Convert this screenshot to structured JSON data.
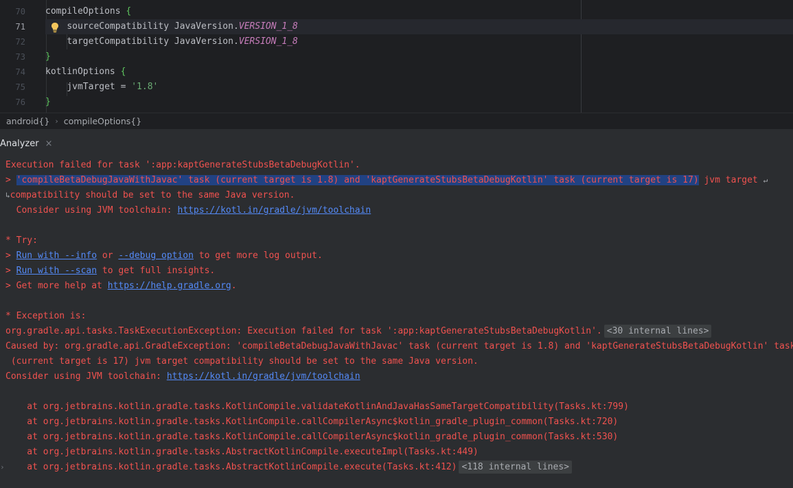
{
  "editor": {
    "line_numbers": [
      "70",
      "71",
      "72",
      "73",
      "74",
      "75",
      "76"
    ],
    "active_line": "71",
    "lines": [
      {
        "indent": "    ",
        "parts": [
          {
            "t": "compileOptions ",
            "c": ""
          },
          {
            "t": "{",
            "c": "c-brace"
          }
        ]
      },
      {
        "indent": "        ",
        "parts": [
          {
            "t": "sourceCompatibility JavaVersion.",
            "c": ""
          },
          {
            "t": "VERSION_1_8",
            "c": "c-purple"
          }
        ]
      },
      {
        "indent": "        ",
        "parts": [
          {
            "t": "targetCompatibility JavaVersion.",
            "c": ""
          },
          {
            "t": "VERSION_1_8",
            "c": "c-purple"
          }
        ]
      },
      {
        "indent": "    ",
        "parts": [
          {
            "t": "}",
            "c": "c-brace"
          }
        ]
      },
      {
        "indent": "    ",
        "parts": [
          {
            "t": "kotlinOptions ",
            "c": ""
          },
          {
            "t": "{",
            "c": "c-brace"
          }
        ]
      },
      {
        "indent": "        ",
        "parts": [
          {
            "t": "jvmTarget = ",
            "c": ""
          },
          {
            "t": "'1.8'",
            "c": "c-str"
          }
        ]
      },
      {
        "indent": "    ",
        "parts": [
          {
            "t": "}",
            "c": "c-brace"
          }
        ]
      }
    ]
  },
  "breadcrumb": {
    "items": [
      "android{}",
      "compileOptions{}"
    ],
    "separator": "›"
  },
  "toolwindow": {
    "title": "Analyzer",
    "close_glyph": "×"
  },
  "console": {
    "line1": "Execution failed for task ':app:kaptGenerateStubsBetaDebugKotlin'.",
    "line2_prefix": "> ",
    "line2_selected": "'compileBetaDebugJavaWithJavac' task (current target is 1.8) and 'kaptGenerateStubsBetaDebugKotlin' task (current target is 17)",
    "line2_rest": " jvm target ",
    "line3": "compatibility should be set to the same Java version.",
    "line4_prefix": "  Consider using JVM toolchain: ",
    "line4_link": "https://kotl.in/gradle/jvm/toolchain",
    "try_header": "* Try:",
    "try1_prefix": "> ",
    "try1_link1": "Run with --info",
    "try1_mid": " or ",
    "try1_link2": "--debug option",
    "try1_suffix": " to get more log output.",
    "try2_prefix": "> ",
    "try2_link": "Run with --scan",
    "try2_suffix": " to get full insights.",
    "try3_prefix": "> Get more help at ",
    "try3_link": "https://help.gradle.org",
    "try3_suffix": ".",
    "exception_header": "* Exception is:",
    "exc_line": "org.gradle.api.tasks.TaskExecutionException: Execution failed for task ':app:kaptGenerateStubsBetaDebugKotlin'.",
    "exc_internal": "<30 internal lines>",
    "caused1": "Caused by: org.gradle.api.GradleException: 'compileBetaDebugJavaWithJavac' task (current target is 1.8) and 'kaptGenerateStubsBetaDebugKotlin' task",
    "caused2": " (current target is 17) jvm target compatibility should be set to the same Java version.",
    "consider2_prefix": "Consider using JVM toolchain: ",
    "consider2_link": "https://kotl.in/gradle/jvm/toolchain",
    "stack": [
      "    at org.jetbrains.kotlin.gradle.tasks.KotlinCompile.validateKotlinAndJavaHasSameTargetCompatibility(Tasks.kt:799)",
      "    at org.jetbrains.kotlin.gradle.tasks.KotlinCompile.callCompilerAsync$kotlin_gradle_plugin_common(Tasks.kt:720)",
      "    at org.jetbrains.kotlin.gradle.tasks.KotlinCompile.callCompilerAsync$kotlin_gradle_plugin_common(Tasks.kt:530)",
      "    at org.jetbrains.kotlin.gradle.tasks.AbstractKotlinCompile.executeImpl(Tasks.kt:449)",
      "    at org.jetbrains.kotlin.gradle.tasks.AbstractKotlinCompile.execute(Tasks.kt:412)"
    ],
    "stack_internal": "<118 internal lines>"
  },
  "colors": {
    "error": "#f0524f",
    "link": "#548af7",
    "selection": "#214283"
  },
  "icons": [
    "lightbulb-icon",
    "close-icon",
    "soft-wrap-icon",
    "fold-arrow-icon"
  ]
}
